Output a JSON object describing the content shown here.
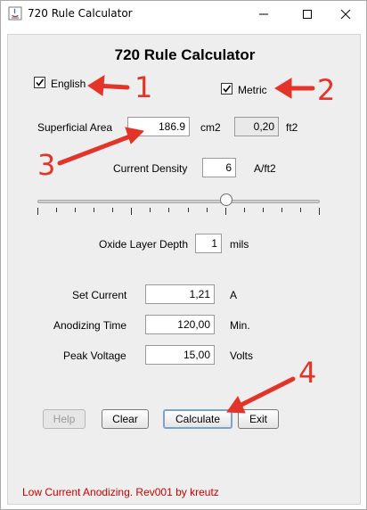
{
  "window": {
    "title": "720 Rule Calculator"
  },
  "heading": "720 Rule Calculator",
  "units": {
    "english_label": "English",
    "english_checked": true,
    "metric_label": "Metric",
    "metric_checked": true
  },
  "area": {
    "label": "Superficial Area",
    "value_cm2": "186.9",
    "unit_cm2": "cm2",
    "value_ft2": "0,20",
    "unit_ft2": "ft2"
  },
  "density": {
    "label": "Current Density",
    "value": "6",
    "unit": "A/ft2",
    "slider_fraction": 0.67
  },
  "oxide": {
    "label": "Oxide Layer Depth",
    "value": "1",
    "unit": "mils"
  },
  "results": {
    "set_current_label": "Set Current",
    "set_current_value": "1,21",
    "set_current_unit": "A",
    "time_label": "Anodizing Time",
    "time_value": "120,00",
    "time_unit": "Min.",
    "voltage_label": "Peak Voltage",
    "voltage_value": "15,00",
    "voltage_unit": "Volts"
  },
  "buttons": {
    "help": "Help",
    "clear": "Clear",
    "calculate": "Calculate",
    "exit": "Exit"
  },
  "status": "Low Current Anodizing. Rev001 by kreutz",
  "annotations": {
    "n1": "1",
    "n2": "2",
    "n3": "3",
    "n4": "4",
    "color": "#e3342a"
  }
}
